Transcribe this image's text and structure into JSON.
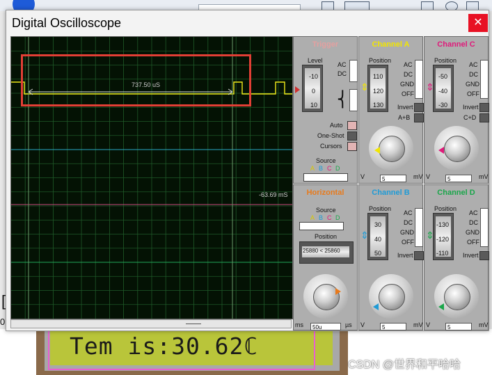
{
  "window": {
    "title": "Digital Oscilloscope",
    "close_glyph": "✕"
  },
  "display": {
    "span_label": "737.50 uS",
    "cursor_time": "-63.69 mS"
  },
  "trigger": {
    "title": "Trigger",
    "level_label": "Level",
    "level_scale": [
      "-10",
      "0",
      "10"
    ],
    "coupling": [
      "AC",
      "DC"
    ],
    "modes": [
      "Auto",
      "One-Shot",
      "Cursors"
    ],
    "source_label": "Source",
    "source_letters": [
      "A",
      "B",
      "C",
      "D"
    ]
  },
  "channel_a": {
    "title": "Channel A",
    "position_label": "Position",
    "position_scale": [
      "110",
      "120",
      "130"
    ],
    "coupling": [
      "AC",
      "DC",
      "GND",
      "OFF"
    ],
    "invert_label": "Invert",
    "combine_label": "A+B",
    "dial_scale": [
      "0.5",
      "0.2",
      "0.1",
      "50",
      "20",
      "10",
      "5",
      "2",
      "1",
      "0.5",
      "0.2",
      "1",
      "2",
      "5",
      "10",
      "20"
    ],
    "unit_left": "V",
    "unit_right": "mV",
    "value": "5"
  },
  "channel_c": {
    "title": "Channel C",
    "position_label": "Position",
    "position_scale": [
      "-50",
      "-40",
      "-30"
    ],
    "coupling": [
      "AC",
      "DC",
      "GND",
      "OFF"
    ],
    "invert_label": "Invert",
    "combine_label": "C+D",
    "unit_left": "V",
    "unit_right": "mV",
    "value": "5"
  },
  "horizontal": {
    "title": "Horizontal",
    "source_label": "Source",
    "source_letters": [
      "A",
      "B",
      "C",
      "D"
    ],
    "position_label": "Position",
    "position_readout": "25880 < 25860",
    "unit_left": "ms",
    "unit_right": "µs",
    "value": "50u"
  },
  "channel_b": {
    "title": "Channel B",
    "position_label": "Position",
    "position_scale": [
      "30",
      "40",
      "50"
    ],
    "coupling": [
      "AC",
      "DC",
      "GND",
      "OFF"
    ],
    "invert_label": "Invert",
    "unit_left": "V",
    "unit_right": "mV",
    "value": "5"
  },
  "channel_d": {
    "title": "Channel D",
    "position_label": "Position",
    "position_scale": [
      "-130",
      "-120",
      "-110"
    ],
    "coupling": [
      "AC",
      "DC",
      "GND",
      "OFF"
    ],
    "invert_label": "Invert",
    "unit_left": "V",
    "unit_right": "mV",
    "value": "5"
  },
  "lcd": {
    "text": "Tem is:30.62ℂ"
  },
  "background": {
    "fragment_1": "[",
    "fragment_2": "01"
  },
  "watermark": "CSDN @世界和平哈哈",
  "colors": {
    "channel_a": "#f2e600",
    "channel_b": "#1f9bd6",
    "channel_c": "#e0197a",
    "channel_d": "#1aa64a",
    "horizontal": "#e87a1c",
    "trigger": "#e4a0a0"
  },
  "icons": [
    "close-icon",
    "oscilloscope-dial-icon"
  ]
}
